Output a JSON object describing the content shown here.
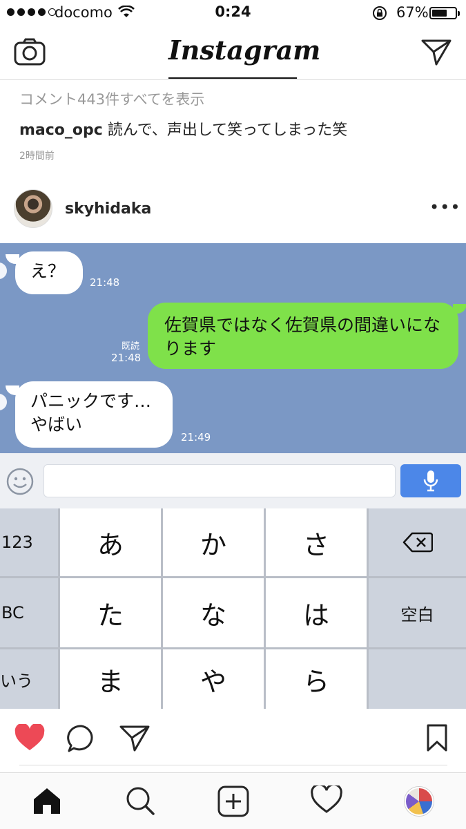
{
  "status_bar": {
    "carrier": "docomo",
    "time": "0:24",
    "battery": "67%",
    "battery_level": 0.67
  },
  "header": {
    "logo": "Instagram",
    "left_icon": "camera-icon",
    "right_icon": "direct-send-icon"
  },
  "post_previous": {
    "view_all_comments": "コメント443件すべてを表示",
    "comment_user": "maco_opc",
    "comment_text": " 読んで、声出して笑ってしまった笑",
    "time_ago": "2時間前"
  },
  "post": {
    "username": "skyhidaka",
    "more": "•••"
  },
  "chat": {
    "messages": [
      {
        "side": "left",
        "text": "え？",
        "time": "21:48"
      },
      {
        "side": "right",
        "text": "佐賀県ではなく佐賀県の間違いになります",
        "time": "21:48",
        "read": "既読"
      },
      {
        "side": "left",
        "text": "パニックです…\nやばい",
        "time": "21:49"
      }
    ],
    "colors": {
      "background": "#7b98c5",
      "sent": "#7fe14a",
      "received": "#ffffff"
    }
  },
  "keyboard": {
    "rows": [
      [
        "123",
        "あ",
        "か",
        "さ",
        "⌫"
      ],
      [
        "BC",
        "た",
        "な",
        "は",
        "空白"
      ],
      [
        "いう",
        "ま",
        "や",
        "ら",
        ""
      ]
    ],
    "mic_color": "#4c87e8"
  },
  "actions": {
    "like_color": "#ed4956",
    "icons": [
      "heart-filled-icon",
      "comment-icon",
      "share-icon",
      "bookmark-icon"
    ]
  },
  "tabbar": {
    "icons": [
      "home-icon",
      "search-icon",
      "add-icon",
      "activity-heart-icon",
      "profile-avatar"
    ]
  }
}
